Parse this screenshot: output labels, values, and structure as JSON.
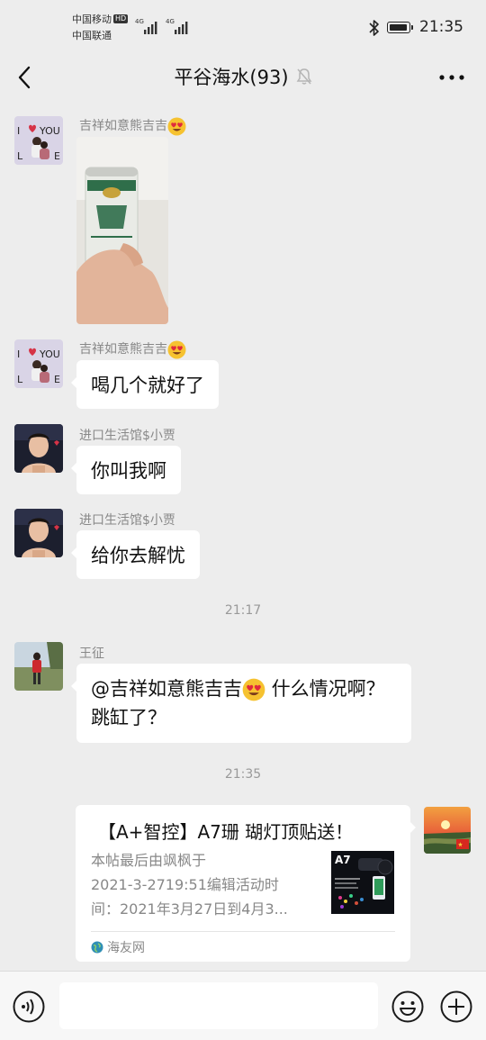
{
  "status_bar": {
    "carrier1": "中国移动",
    "hd_badge": "HD",
    "carrier2": "中国联通",
    "signal1_label": "4G",
    "signal2_label": "4G",
    "time": "21:35"
  },
  "header": {
    "title": "平谷海水(93)"
  },
  "messages": [
    {
      "sender": "吉祥如意熊吉吉",
      "type": "image"
    },
    {
      "sender": "吉祥如意熊吉吉",
      "text": "喝几个就好了"
    },
    {
      "sender": "进口生活馆$小贾",
      "text": "你叫我啊"
    },
    {
      "sender": "进口生活馆$小贾",
      "text": "给你去解忧"
    },
    {
      "sender": "王征",
      "mention": "@吉祥如意熊吉吉",
      "text_after": " 什么情况啊？",
      "text_line2": "跳缸了？"
    }
  ],
  "timestamps": [
    "21:17",
    "21:35"
  ],
  "link_card": {
    "title": "【A+智控】A7珊 瑚灯顶贴送！",
    "desc_lines": [
      "本帖最后由飒枫于",
      "2021-3-2719:51编辑活动时",
      "间：2021年3月27日到4月3..."
    ],
    "thumb_label": "A7",
    "source": "海友网"
  },
  "input": {
    "placeholder": ""
  }
}
